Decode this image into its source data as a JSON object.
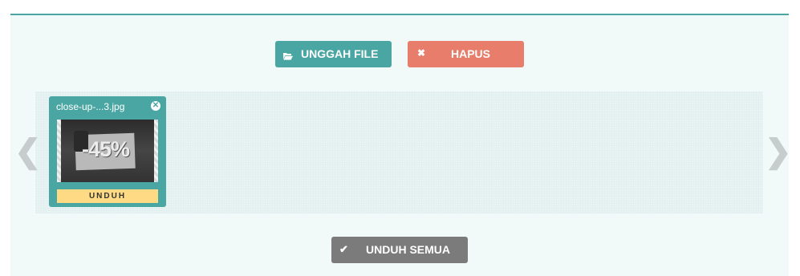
{
  "toolbar": {
    "upload_label": "UNGGAH FILE",
    "upload_icon": "folder-open-icon",
    "delete_label": "HAPUS",
    "delete_icon": "close-icon"
  },
  "gallery": {
    "prev_arrow": "❮",
    "next_arrow": "❯",
    "files": [
      {
        "name": "close-up-...3.jpg",
        "thumbnail_text": "-45%",
        "download_label": "UNDUH"
      }
    ]
  },
  "footer": {
    "download_all_label": "UNDUH SEMUA",
    "download_all_icon": "check-icon"
  },
  "colors": {
    "accent": "#4aa6a2",
    "danger": "#e77d6a",
    "neutral": "#7b7b7b",
    "download": "#fdda83"
  }
}
